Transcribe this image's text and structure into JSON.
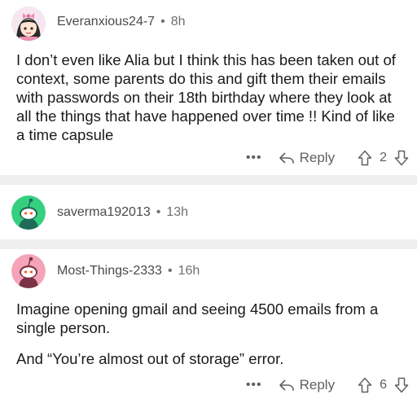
{
  "comments": [
    {
      "username": "Everanxious24-7",
      "time": "8h",
      "separator": "•",
      "paragraphs": [
        "I don’t even like Alia but I think this has been taken out of context, some parents do this and gift them their emails with passwords on their 18th birthday where they look at all the things that have happened over time !! Kind of like a time capsule"
      ],
      "more_label": "•••",
      "reply_label": "Reply",
      "vote_count": "2"
    },
    {
      "username": "saverma192013",
      "time": "13h",
      "separator": "•"
    },
    {
      "username": "Most-Things-2333",
      "time": "16h",
      "separator": "•",
      "paragraphs": [
        "Imagine opening gmail and seeing 4500 emails from a single person.",
        "And “You’re almost out of storage” error."
      ],
      "more_label": "•••",
      "reply_label": "Reply",
      "vote_count": "6"
    }
  ],
  "colors": {
    "divider": "#efeff0",
    "avatar_green": "#2ecc71",
    "avatar_pink": "#f5a3b8",
    "text": "#1a1a1b",
    "meta": "#6f7071"
  },
  "icons": {
    "reply": "reply-arrow-icon",
    "upvote": "upvote-arrow-icon",
    "downvote": "downvote-arrow-icon",
    "more": "more-options-icon"
  }
}
